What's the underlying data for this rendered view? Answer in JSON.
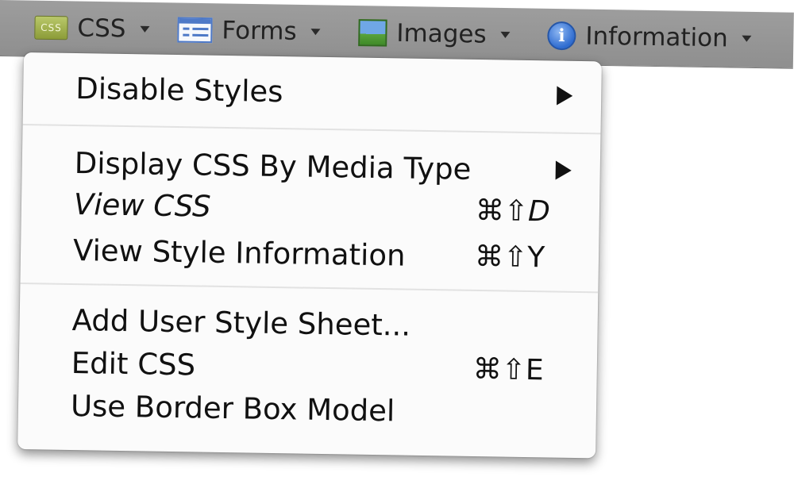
{
  "toolbar": {
    "items": [
      {
        "label": "CSS",
        "icon": "css-icon"
      },
      {
        "label": "Forms",
        "icon": "forms-icon"
      },
      {
        "label": "Images",
        "icon": "images-icon"
      },
      {
        "label": "Information",
        "icon": "info-icon"
      }
    ],
    "css_icon_text": "CSS",
    "info_icon_text": "i"
  },
  "menu": {
    "items": [
      {
        "label": "Disable Styles",
        "submenu": true,
        "shortcut": ""
      },
      {
        "label": "Display CSS By Media Type",
        "submenu": true,
        "shortcut": ""
      },
      {
        "label": "View CSS",
        "submenu": false,
        "shortcut": "⌘⇧D"
      },
      {
        "label": "View Style Information",
        "submenu": false,
        "shortcut": "⌘⇧Y"
      },
      {
        "label": "Add User Style Sheet...",
        "submenu": false,
        "shortcut": ""
      },
      {
        "label": "Edit CSS",
        "submenu": false,
        "shortcut": "⌘⇧E"
      },
      {
        "label": "Use Border Box Model",
        "submenu": false,
        "shortcut": ""
      }
    ]
  }
}
